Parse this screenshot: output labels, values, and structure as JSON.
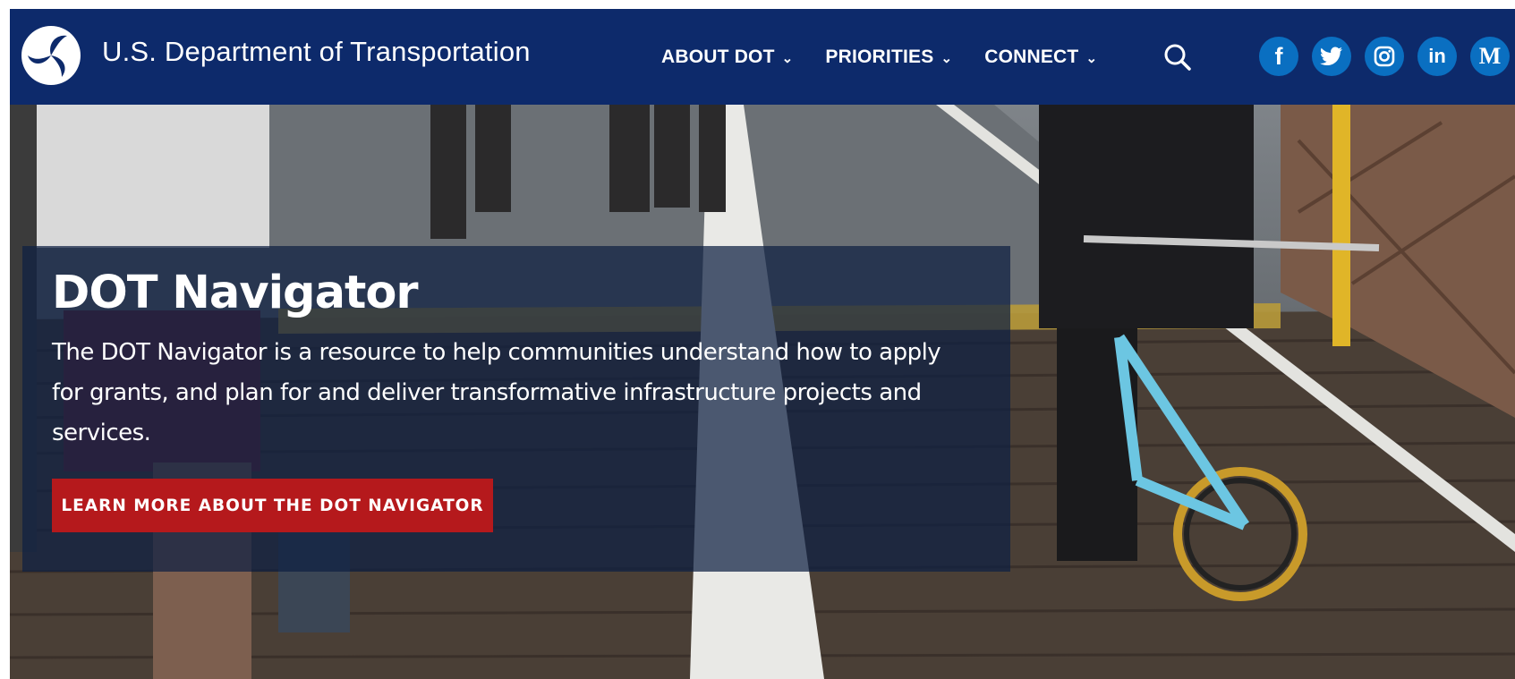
{
  "header": {
    "site_title": "U.S. Department of Transportation",
    "logo_icon": "dot-tri-star-logo-icon",
    "nav": [
      {
        "label": "ABOUT DOT"
      },
      {
        "label": "PRIORITIES"
      },
      {
        "label": "CONNECT"
      }
    ],
    "search_icon": "search-icon",
    "social": [
      {
        "name": "facebook",
        "glyph": "f"
      },
      {
        "name": "twitter",
        "glyph": "t"
      },
      {
        "name": "instagram",
        "glyph": "ig"
      },
      {
        "name": "linkedin",
        "glyph": "in"
      },
      {
        "name": "medium",
        "glyph": "M"
      }
    ]
  },
  "hero": {
    "title": "DOT Navigator",
    "description": "The DOT Navigator is a resource to help communities understand how to apply for grants, and plan for and deliver transformative infrastructure projects and services.",
    "cta_label": "LEARN MORE ABOUT THE DOT NAVIGATOR",
    "image_subject": "pedestrians and a cyclist on a bridge walkway"
  },
  "colors": {
    "header_bg": "#0d2a6b",
    "social_bg": "#0a6fc1",
    "cta_bg": "#b5191c",
    "panel_bg": "rgba(14,32,66,0.72)"
  }
}
